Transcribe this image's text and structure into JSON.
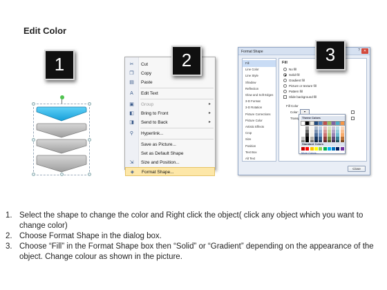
{
  "title": "Edit Color",
  "steps": {
    "one": "1",
    "two": "2",
    "three": "3"
  },
  "context_menu": {
    "items": [
      {
        "icon": "scissors-icon",
        "glyph": "✂",
        "label": "Cut",
        "disabled": false,
        "submenu": false
      },
      {
        "icon": "copy-icon",
        "glyph": "❐",
        "label": "Copy",
        "disabled": false,
        "submenu": false
      },
      {
        "icon": "paste-icon",
        "glyph": "▤",
        "label": "Paste",
        "disabled": false,
        "submenu": false
      },
      {
        "icon": "edit-text-icon",
        "glyph": "A",
        "label": "Edit Text",
        "disabled": false,
        "submenu": false
      },
      {
        "icon": "group-icon",
        "glyph": "▣",
        "label": "Group",
        "disabled": true,
        "submenu": true
      },
      {
        "icon": "bring-to-front-icon",
        "glyph": "◧",
        "label": "Bring to Front",
        "disabled": false,
        "submenu": true
      },
      {
        "icon": "send-to-back-icon",
        "glyph": "◨",
        "label": "Send to Back",
        "disabled": false,
        "submenu": true
      },
      {
        "icon": "hyperlink-icon",
        "glyph": "⚲",
        "label": "Hyperlink...",
        "disabled": false,
        "submenu": false
      },
      {
        "icon": "",
        "glyph": "",
        "label": "Save as Picture...",
        "disabled": false,
        "submenu": false
      },
      {
        "icon": "",
        "glyph": "",
        "label": "Set as Default Shape",
        "disabled": false,
        "submenu": false
      },
      {
        "icon": "size-position-icon",
        "glyph": "⇲",
        "label": "Size and Position...",
        "disabled": false,
        "submenu": false
      },
      {
        "icon": "format-shape-icon",
        "glyph": "◈",
        "label": "Format Shape...",
        "disabled": false,
        "submenu": false
      }
    ]
  },
  "dialog": {
    "title": "Format Shape",
    "close_label": "Close",
    "categories": [
      "Fill",
      "Line Color",
      "Line Style",
      "Shadow",
      "Reflection",
      "Glow and Soft Edges",
      "3-D Format",
      "3-D Rotation",
      "Picture Corrections",
      "Picture Color",
      "Artistic Effects",
      "Crop",
      "Size",
      "Position",
      "Text Box",
      "Alt Text"
    ],
    "fill_heading": "Fill",
    "options": [
      "No fill",
      "Solid fill",
      "Gradient fill",
      "Picture or texture fill",
      "Pattern fill",
      "Slide background fill"
    ],
    "fill_color_label": "Fill Color",
    "color_label": "Color:",
    "transparency_label": "Transpa",
    "theme_colors_label": "Theme Colors",
    "standard_colors_label": "Standard Colors",
    "more_colors_label": "More Colors...",
    "theme_colors": [
      "#ffffff",
      "#000000",
      "#eeece1",
      "#1f497d",
      "#4f81bd",
      "#c0504d",
      "#9bbb59",
      "#8064a2",
      "#4bacc6",
      "#f79646"
    ],
    "standard_colors": [
      "#c00000",
      "#ff0000",
      "#ffc000",
      "#ffff00",
      "#92d050",
      "#00b050",
      "#00b0f0",
      "#0070c0",
      "#002060",
      "#7030a0"
    ]
  },
  "instructions": [
    {
      "num": "1.",
      "text": "Select the shape to change the color and Right click the object( click any object which you want to change color)"
    },
    {
      "num": "2.",
      "text": "Choose Format Shape in the dialog box."
    },
    {
      "num": "3.",
      "text": "Choose “Fill” in the Format Shape box then “Solid” or “Gradient” depending on the appearance of the object. Change colour as shown in the picture."
    }
  ],
  "colors": {
    "accent_blue": "#29b8ee",
    "shape_gray": "#b5b5b5",
    "menu_highlight": "#fde7a8"
  }
}
